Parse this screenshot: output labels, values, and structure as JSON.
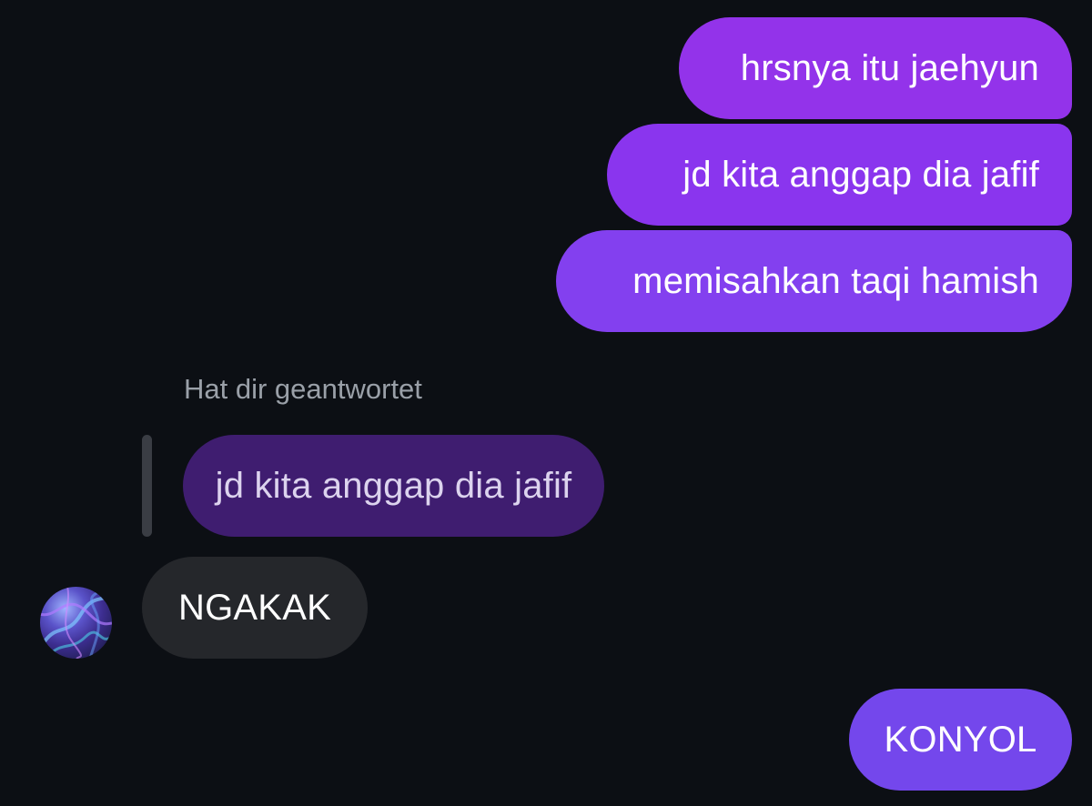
{
  "conversation": {
    "sent": [
      {
        "text": "hrsnya itu jaehyun"
      },
      {
        "text": "jd kita anggap dia jafif"
      },
      {
        "text": "memisahkan taqi hamish"
      },
      {
        "text": "KONYOL"
      }
    ],
    "reply_context": {
      "label": "Hat dir geantwortet",
      "quoted_text": "jd kita anggap dia jafif"
    },
    "received": [
      {
        "text": "NGAKAK",
        "avatar_icon": "user-avatar-image"
      }
    ]
  },
  "colors": {
    "background": "#0c0f14",
    "sent_bubble": "#8a35ee",
    "sent_bubble_last": "#7447ec",
    "quoted_bubble": "#3f1d70",
    "received_bubble": "#25272b",
    "meta_text": "#9aa0a8"
  }
}
